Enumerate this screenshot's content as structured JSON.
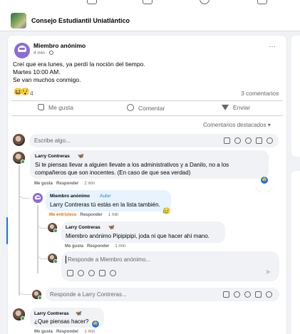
{
  "group": {
    "name": "Consejo Estudiantil Uniatlántico"
  },
  "post": {
    "author": "Miembro anónimo",
    "time": "4 min · ",
    "more": "···",
    "text_lines": [
      "Creí que era lunes, ya perdí la noción del tiempo.",
      "Martes 10:00 AM.",
      "Se van muchos conmigo."
    ],
    "reaction_count": "4",
    "comments_count": "3 comentarios"
  },
  "actions": {
    "like": "Me gusta",
    "comment": "Comentar",
    "send": "Enviar"
  },
  "sort": {
    "label": "Comentarios destacados",
    "chevron": "▾"
  },
  "composer": {
    "placeholder": "Escribe algo..."
  },
  "comments": [
    {
      "name": "Larry Contreras",
      "lines": [
        "Si te piensas llevar a alguien llevate a los administrativos y a Danilo, no a los",
        "compañeros que son inocentes. (En caso de que sea verdad)"
      ],
      "like": "Me gusta",
      "reply": "Responder",
      "time": "2 min"
    },
    {
      "name": "Miembro anónimo",
      "badge": "Autor",
      "lines": [
        "Larry Contreras tú estás en la lista también."
      ],
      "like": "Me entristece",
      "reply": "Responder",
      "time": "1 min"
    },
    {
      "name": "Larry Contreras",
      "lines": [
        "Miembro anónimo Pipipipipi, joda ni que hacer ahí mano."
      ],
      "like": "Me gusta",
      "reply": "Responder",
      "time": "1 min"
    },
    {
      "name": "Larry Contreras",
      "lines": [
        "¿Que piensas hacer?"
      ],
      "like": "Me gusta",
      "reply": "Responder",
      "time": "1 min"
    }
  ],
  "reply_anon": {
    "placeholder": "Responde a Miembro anónimo..."
  },
  "reply_larry": {
    "placeholder": "Responde a Larry Contreras..."
  },
  "icons": {
    "emojis": [
      "😆",
      "😯"
    ],
    "sad": "😥",
    "like_thumb": "👍",
    "crown": "🦋",
    "send_arrow": "➤"
  },
  "colors": {
    "accent": "#1877f2",
    "author_badge": "#1b74e4",
    "sad_reaction": "#e9710f"
  }
}
